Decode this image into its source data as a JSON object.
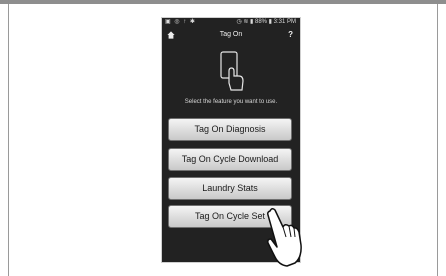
{
  "status_bar": {
    "left_icons": "▣ ◎ ↑ ✱",
    "right_text": "◷ ≋ ▮ 88% ▮ 3:31 PM"
  },
  "header": {
    "title": "Tag On",
    "help": "?",
    "home_icon": "home-icon"
  },
  "main": {
    "instruction": "Select the feature you want to use.",
    "buttons": [
      {
        "label": "Tag On Diagnosis"
      },
      {
        "label": "Tag On Cycle Download"
      },
      {
        "label": "Laundry Stats"
      },
      {
        "label": "Tag On Cycle Set"
      }
    ]
  },
  "colors": {
    "phone_background": "#222222",
    "button_top": "#f4f4f4",
    "button_bottom": "#c9c9c9"
  }
}
